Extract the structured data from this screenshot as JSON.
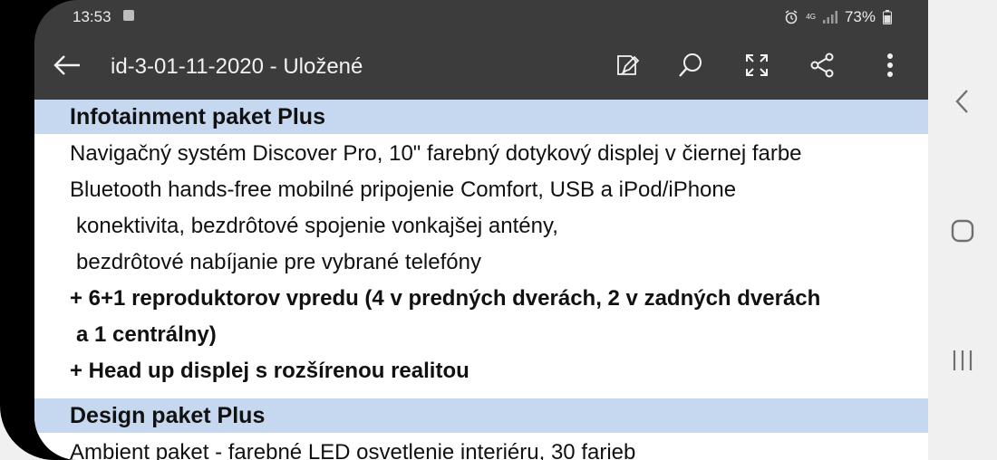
{
  "status_bar": {
    "time": "13:53",
    "network": "4G",
    "battery": "73%"
  },
  "toolbar": {
    "title": "id-3-01-11-2020 - Uložené",
    "icons": [
      "back-arrow-icon",
      "edit-icon",
      "search-icon",
      "fullscreen-icon",
      "share-icon",
      "more-vert-icon"
    ]
  },
  "document": {
    "sections": [
      {
        "title": "Infotainment paket Plus",
        "lines": [
          "Navigačný systém Discover Pro, 10\" farebný dotykový displej v čiernej farbe",
          "Bluetooth hands-free mobilné pripojenie Comfort, USB a iPod/iPhone",
          " konektivita, bezdrôtové spojenie vonkajšej antény,",
          " bezdrôtové nabíjanie pre vybrané telefóny",
          "+ 6+1 reproduktorov vpredu (4 v predných dverách, 2 v zadných dverách",
          " a 1 centrálny)",
          "+ Head up displej s rozšírenou realitou"
        ]
      },
      {
        "title": "Design paket Plus",
        "lines": [
          "Ambient paket - farebné LED osvetlenie interiéru, 30 farieb"
        ]
      }
    ]
  },
  "nav_bar": {
    "icons": [
      "nav-back-icon",
      "nav-home-icon",
      "nav-recents-icon"
    ]
  },
  "colors": {
    "toolbar_bg": "#3c3c3c",
    "section_header_bg": "#c5d8ef",
    "page_bg": "#ffffff",
    "nav_bg": "#f0f0f0"
  }
}
